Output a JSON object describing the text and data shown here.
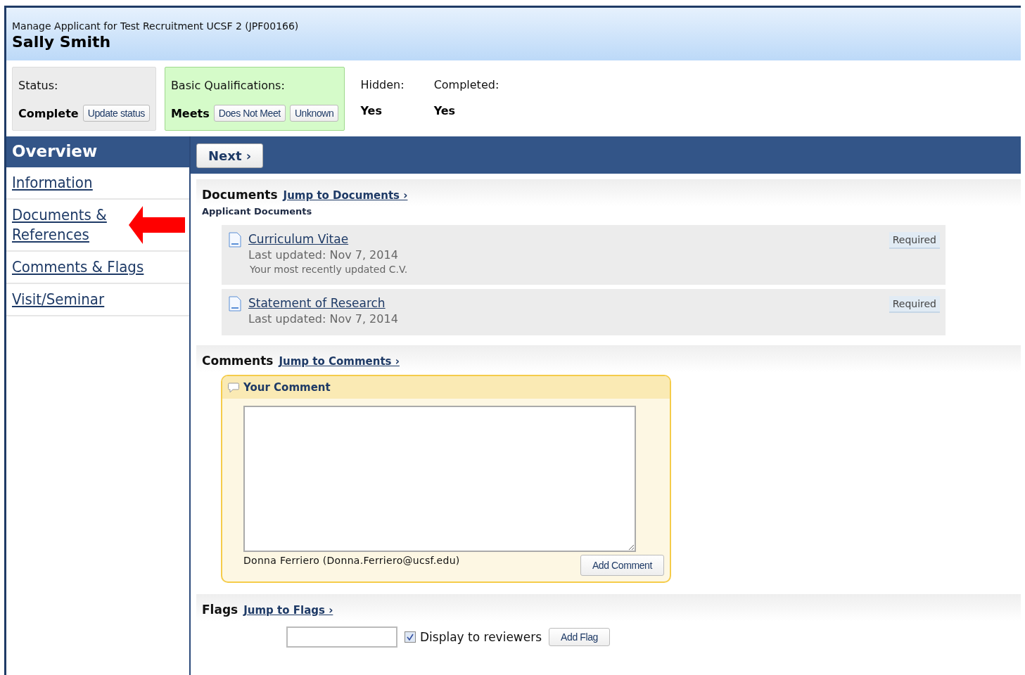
{
  "header": {
    "subtitle": "Manage Applicant for Test Recruitment UCSF 2 (JPF00166)",
    "name": "Sally Smith"
  },
  "status": {
    "label": "Status:",
    "value": "Complete",
    "button": "Update status"
  },
  "qualifications": {
    "label": "Basic Qualifications:",
    "value": "Meets",
    "buttons": [
      "Does Not Meet",
      "Unknown"
    ]
  },
  "facts": [
    {
      "label": "Hidden:",
      "value": "Yes"
    },
    {
      "label": "Completed:",
      "value": "Yes"
    }
  ],
  "sidebar": {
    "title": "Overview",
    "items": [
      {
        "label": "Information",
        "annotated": false
      },
      {
        "label": "Documents & References",
        "annotated": true
      },
      {
        "label": "Comments & Flags",
        "annotated": false
      },
      {
        "label": "Visit/Seminar",
        "annotated": false
      }
    ]
  },
  "next_button": "Next ›",
  "documents": {
    "title": "Documents",
    "jump": "Jump to Documents ›",
    "subtitle": "Applicant Documents",
    "items": [
      {
        "name": "Curriculum Vitae",
        "updated": "Last updated: Nov 7, 2014",
        "description": "Your most recently updated C.V.",
        "badge": "Required"
      },
      {
        "name": "Statement of Research",
        "updated": "Last updated: Nov 7, 2014",
        "badge": "Required"
      }
    ]
  },
  "comments": {
    "title": "Comments",
    "jump": "Jump to Comments ›",
    "box_title": "Your Comment",
    "author": "Donna Ferriero (Donna.Ferriero@ucsf.edu)",
    "button": "Add Comment"
  },
  "flags": {
    "title": "Flags",
    "jump": "Jump to Flags ›",
    "checkbox_label": "Display to reviewers",
    "checked": true,
    "button": "Add Flag"
  }
}
